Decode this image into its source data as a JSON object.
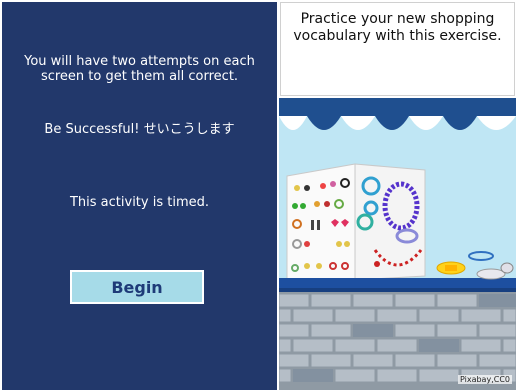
{
  "instructions": {
    "attempts_text": "You will have two attempts on each screen to get them all correct.",
    "success_text": "Be Successful! せいこうします",
    "timed_text": "This activity is timed."
  },
  "begin_button": {
    "label": "Begin"
  },
  "intro": {
    "text": "Practice your new shopping vocabulary with this exercise."
  },
  "image": {
    "credit": "Pixabay,CC0"
  },
  "colors": {
    "panel_bg": "#22386b",
    "button_bg": "#a6dbe8",
    "button_text": "#1e3b78",
    "awning_blue": "#1f4f8f"
  }
}
